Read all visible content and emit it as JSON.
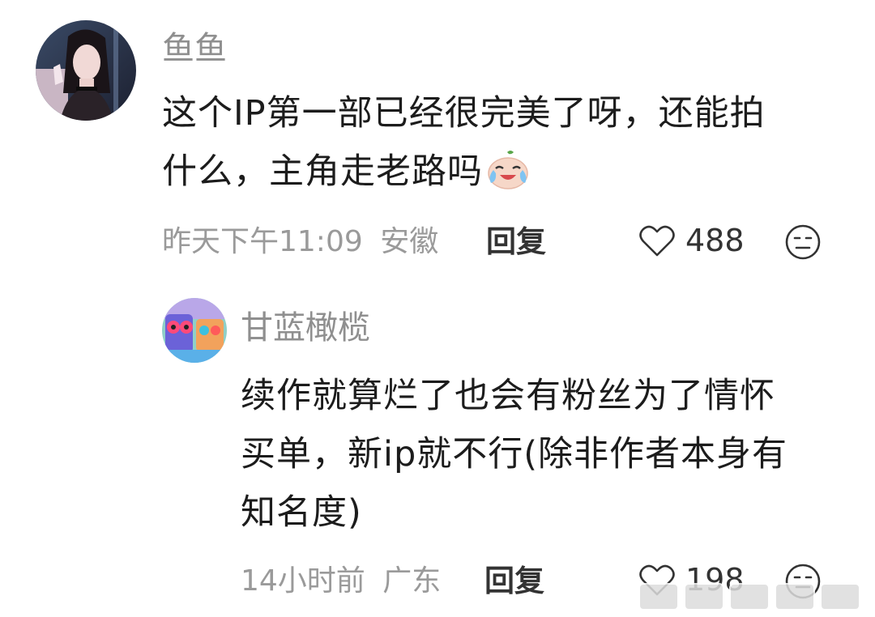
{
  "comments": [
    {
      "username": "鱼鱼",
      "avatar_icon": "avatar-girl-icon",
      "text_lines": [
        "这个IP第一部已经很完美了呀，还能拍",
        "什么，主角走老路吗"
      ],
      "emoji_icon": "crying-laughing-emoji-icon",
      "time": "昨天下午11:09",
      "location": "安徽",
      "reply_label": "回复",
      "like_count": "488"
    },
    {
      "username": "甘蓝橄榄",
      "avatar_icon": "avatar-cartoon-icon",
      "text_lines": [
        "续作就算烂了也会有粉丝为了情怀",
        "买单，新ip就不行(除非作者本身有",
        "知名度)"
      ],
      "time": "14小时前",
      "location": "广东",
      "reply_label": "回复",
      "like_count": "198"
    }
  ],
  "colors": {
    "username": "#8f8f8f",
    "text": "#1c1c1c",
    "meta": "#9a9a9a",
    "action": "#333333"
  }
}
